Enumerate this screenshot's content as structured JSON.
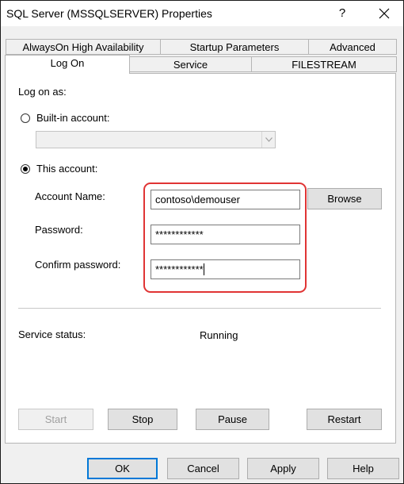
{
  "window": {
    "title": "SQL Server (MSSQLSERVER) Properties",
    "help_glyph": "?"
  },
  "tabs": {
    "row1": [
      "AlwaysOn High Availability",
      "Startup Parameters",
      "Advanced"
    ],
    "row2": [
      "Log On",
      "Service",
      "FILESTREAM"
    ],
    "active": "Log On"
  },
  "logon": {
    "section_label": "Log on as:",
    "builtin_label": "Built-in account:",
    "builtin_value": "",
    "this_account_label": "This account:",
    "selected": "This account",
    "account_name_label": "Account Name:",
    "account_name_value": "contoso\\demouser",
    "browse_label": "Browse",
    "password_label": "Password:",
    "password_value": "************",
    "confirm_label": "Confirm password:",
    "confirm_value": "************"
  },
  "status": {
    "label": "Service status:",
    "value": "Running"
  },
  "service_buttons": {
    "start": "Start",
    "stop": "Stop",
    "pause": "Pause",
    "restart": "Restart"
  },
  "dialog_buttons": {
    "ok": "OK",
    "cancel": "Cancel",
    "apply": "Apply",
    "help": "Help"
  },
  "colors": {
    "highlight": "#e03434",
    "default_button_border": "#0078d7"
  }
}
